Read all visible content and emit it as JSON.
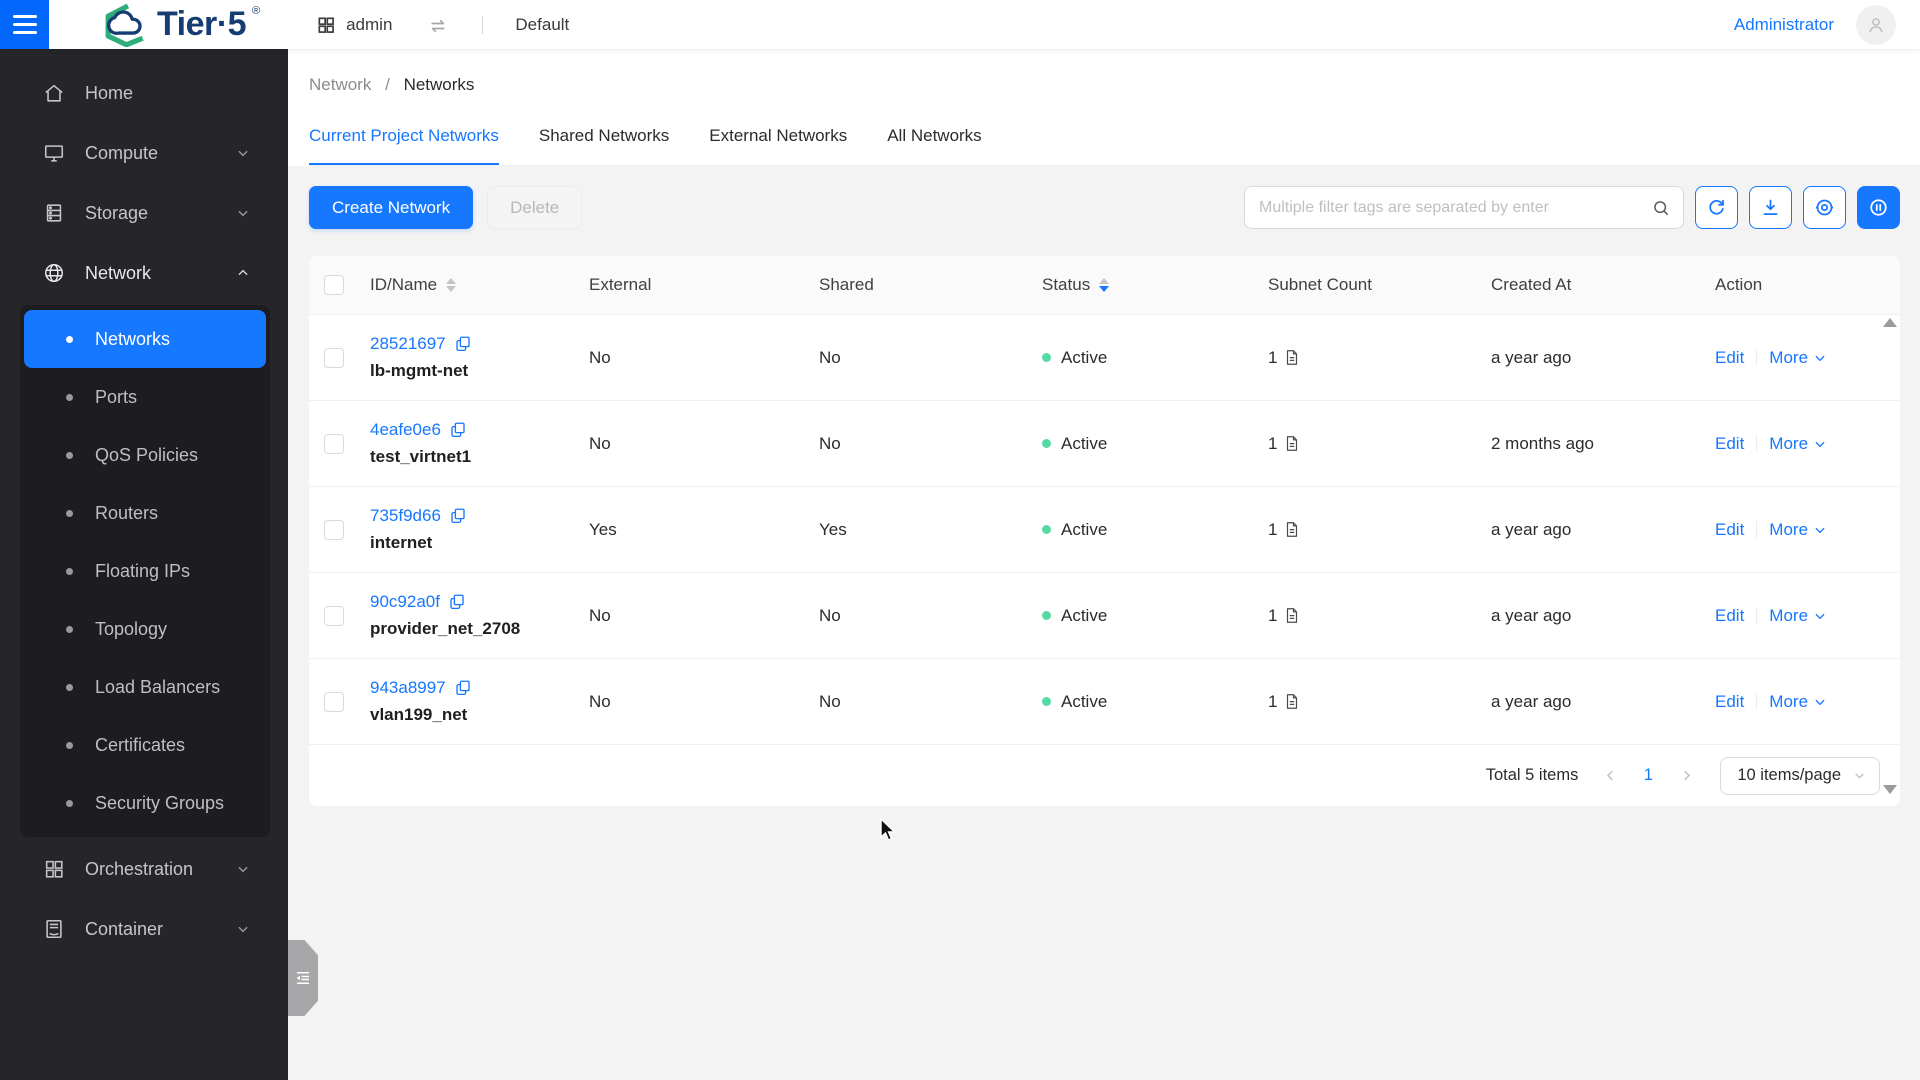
{
  "header": {
    "brand": "Tier·5",
    "brand_mark": "®",
    "project_label": "admin",
    "domain_label": "Default",
    "user_label": "Administrator"
  },
  "sidebar": {
    "items": [
      {
        "label": "Home",
        "icon": "home-icon"
      },
      {
        "label": "Compute",
        "icon": "desktop-icon",
        "expandable": true
      },
      {
        "label": "Storage",
        "icon": "storage-icon",
        "expandable": true
      },
      {
        "label": "Network",
        "icon": "globe-icon",
        "expandable": true,
        "expanded": true
      },
      {
        "label": "Orchestration",
        "icon": "grid-icon",
        "expandable": true
      },
      {
        "label": "Container",
        "icon": "container-icon",
        "expandable": true
      }
    ],
    "network_children": [
      {
        "label": "Networks",
        "active": true
      },
      {
        "label": "Ports"
      },
      {
        "label": "QoS Policies"
      },
      {
        "label": "Routers"
      },
      {
        "label": "Floating IPs"
      },
      {
        "label": "Topology"
      },
      {
        "label": "Load Balancers"
      },
      {
        "label": "Certificates"
      },
      {
        "label": "Security Groups"
      }
    ]
  },
  "breadcrumb": {
    "parent": "Network",
    "separator": "/",
    "current": "Networks"
  },
  "tabs": [
    {
      "label": "Current Project Networks",
      "active": true
    },
    {
      "label": "Shared Networks",
      "active": false
    },
    {
      "label": "External Networks",
      "active": false
    },
    {
      "label": "All Networks",
      "active": false
    }
  ],
  "toolbar": {
    "create_label": "Create Network",
    "delete_label": "Delete",
    "search_placeholder": "Multiple filter tags are separated by enter",
    "icon_buttons": [
      "refresh-icon",
      "download-icon",
      "visibility-icon",
      "pause-circle-icon"
    ]
  },
  "table": {
    "columns": [
      "ID/Name",
      "External",
      "Shared",
      "Status",
      "Subnet Count",
      "Created At",
      "Action"
    ],
    "sort": {
      "column": "Status",
      "direction": "descending"
    },
    "actions": {
      "edit": "Edit",
      "more": "More"
    },
    "rows": [
      {
        "id": "28521697",
        "name": "lb-mgmt-net",
        "external": "No",
        "shared": "No",
        "status": "Active",
        "subnet_count": "1",
        "created_at": "a year ago"
      },
      {
        "id": "4eafe0e6",
        "name": "test_virtnet1",
        "external": "No",
        "shared": "No",
        "status": "Active",
        "subnet_count": "1",
        "created_at": "2 months ago"
      },
      {
        "id": "735f9d66",
        "name": "internet",
        "external": "Yes",
        "shared": "Yes",
        "status": "Active",
        "subnet_count": "1",
        "created_at": "a year ago"
      },
      {
        "id": "90c92a0f",
        "name": "provider_net_2708",
        "external": "No",
        "shared": "No",
        "status": "Active",
        "subnet_count": "1",
        "created_at": "a year ago"
      },
      {
        "id": "943a8997",
        "name": "vlan199_net",
        "external": "No",
        "shared": "No",
        "status": "Active",
        "subnet_count": "1",
        "created_at": "a year ago"
      }
    ]
  },
  "pagination": {
    "total": "Total 5 items",
    "current_page": "1",
    "page_size": "10 items/page"
  },
  "colors": {
    "accent": "#1677ff",
    "hamburger_blue": "#0367fc",
    "brand_navy": "#163c74",
    "brand_green": "#2fae7b",
    "status_active_dot": "#57d9a3",
    "sidebar_bg": "#25252a",
    "page_bg": "#f3f3f3"
  },
  "icons": {
    "menu": "hamburger-icon",
    "project": "grid-icon",
    "switch": "swap-icon",
    "user": "person-icon",
    "search": "magnifier-icon",
    "copy": "copy-icon",
    "subnet": "file-icon",
    "sorter": "caret-icons",
    "scroll": "triangle-arrows",
    "drawer": "outdent-icon"
  }
}
